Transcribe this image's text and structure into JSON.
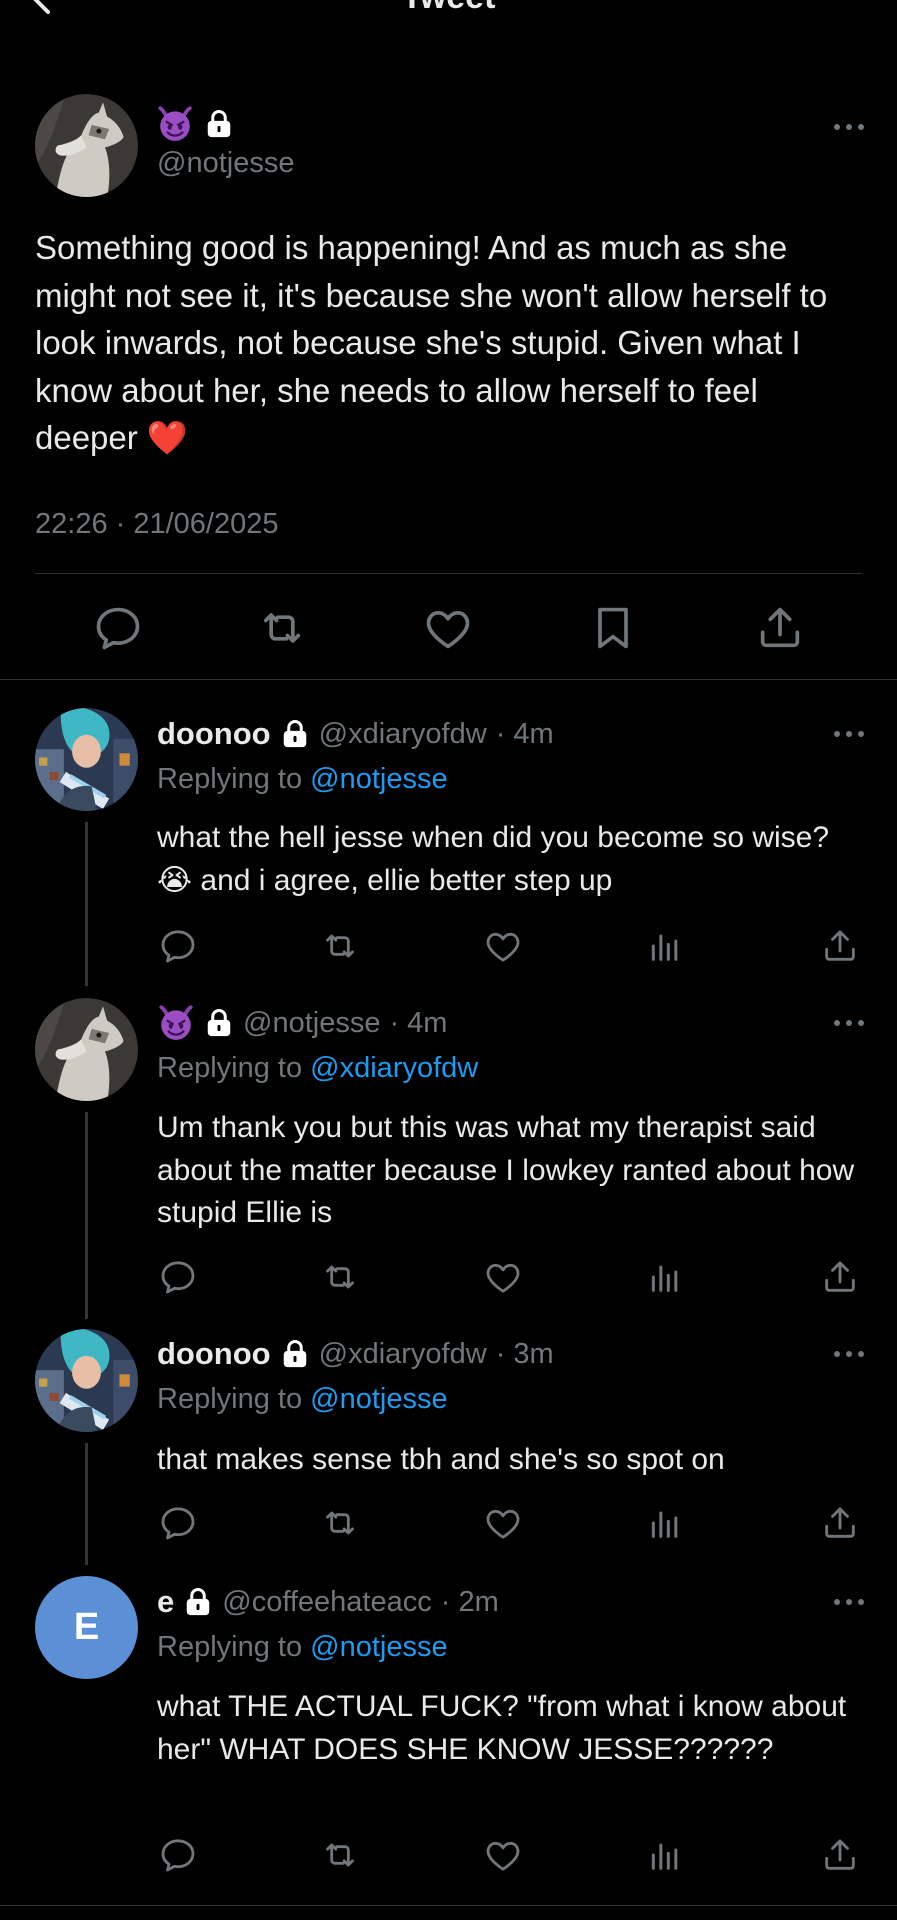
{
  "header": {
    "title": "Tweet"
  },
  "main_tweet": {
    "display_name_emoji": "😈",
    "handle": "@notjesse",
    "text": "Something good is happening! And as much as she might not see it, it's because she won't allow herself to look inwards, not because she's stupid. Given what I know about her, she needs to allow herself to feel deeper ❤️",
    "timestamp": "22:26 · 21/06/2025",
    "actions": [
      "reply-icon",
      "retweet-icon",
      "like-icon",
      "bookmark-icon",
      "share-icon"
    ]
  },
  "replies": [
    {
      "name": "doonoo",
      "handle": "@xdiaryofdw",
      "time": "· 4m",
      "replying_prefix": "Replying to ",
      "replying_to": "@notjesse",
      "text": "what the hell jesse when did you become so wise? 😭 and i agree, ellie better step up"
    },
    {
      "name": "😈",
      "handle": "@notjesse",
      "time": "· 4m",
      "replying_prefix": "Replying to ",
      "replying_to": "@xdiaryofdw",
      "text": "Um thank you but this was what my therapist said about the matter because I lowkey ranted about how stupid Ellie is"
    },
    {
      "name": "doonoo",
      "handle": "@xdiaryofdw",
      "time": "· 3m",
      "replying_prefix": "Replying to ",
      "replying_to": "@notjesse",
      "text": "that makes sense tbh and she's so spot on"
    },
    {
      "name": "e",
      "avatar_letter": "E",
      "handle": "@coffeehateacc",
      "time": "· 2m",
      "replying_prefix": "Replying to ",
      "replying_to": "@notjesse",
      "text": "what THE ACTUAL FUCK? \"from what i know about her\" WHAT DOES SHE KNOW JESSE??????"
    }
  ],
  "colors": {
    "background": "#000000",
    "text": "#e7e9ea",
    "muted": "#71767b",
    "link": "#1d9bf0",
    "divider": "#2f3336",
    "avatar_e": "#5b8fd6"
  }
}
